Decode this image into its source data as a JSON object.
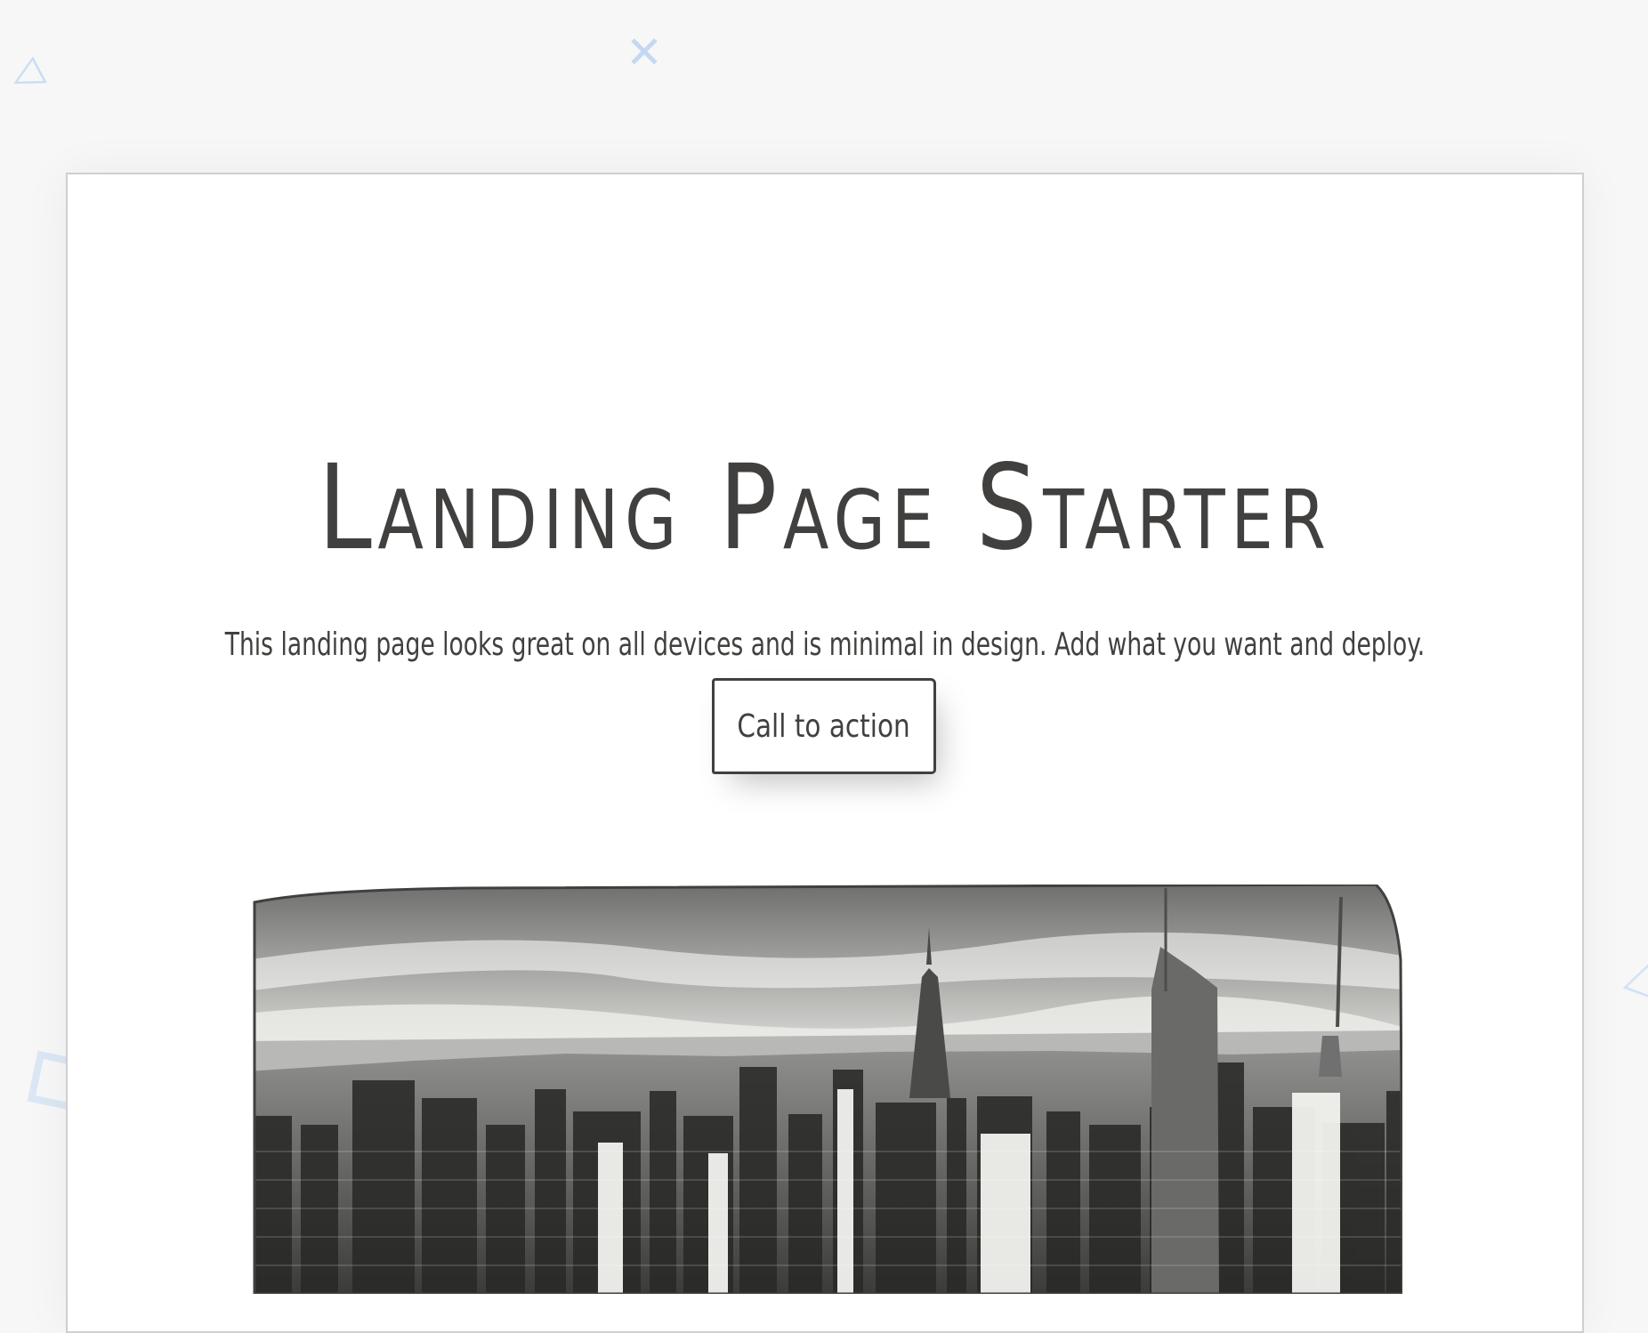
{
  "hero": {
    "title": "Landing Page Starter",
    "subtitle": "This landing page looks great on all devices and is minimal in design. Add what you want and deploy.",
    "cta_label": "Call to action",
    "image": "city skyline photograph"
  },
  "background_shapes": [
    "triangle-shape",
    "cross-shape",
    "square-shape",
    "triangle-shape"
  ],
  "colors": {
    "text": "#41403e",
    "page_background": "#f7f7f7",
    "card_background": "#ffffff",
    "shape_accent": "#c9dcf3"
  }
}
